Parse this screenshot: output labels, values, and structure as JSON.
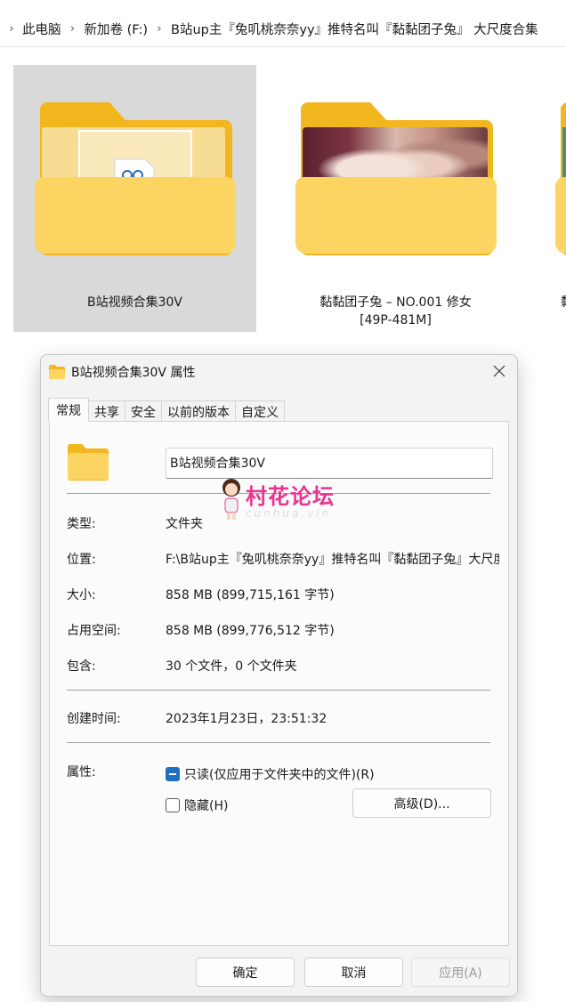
{
  "breadcrumb": {
    "items": [
      "此电脑",
      "新加卷 (F:)",
      "B站up主『兔叽桃奈奈yy』推特名叫『黏黏团子兔』 大尺度合集"
    ]
  },
  "tiles": [
    {
      "name_lines": [
        "B站视频合集30V"
      ],
      "selected": true
    },
    {
      "name_lines": [
        "黏黏团子兔 – NO.001 修女",
        "[49P-481M]"
      ],
      "selected": false
    },
    {
      "name_lines": [
        "黏"
      ],
      "selected": false
    }
  ],
  "dialog": {
    "title": "B站视频合集30V 属性",
    "tabs": [
      "常规",
      "共享",
      "安全",
      "以前的版本",
      "自定义"
    ],
    "active_tab": 0,
    "folder_name": "B站视频合集30V",
    "watermark": {
      "text": "村花论坛",
      "sub": "cunhua.vin"
    },
    "rows": {
      "type": {
        "label": "类型:",
        "value": "文件夹"
      },
      "location": {
        "label": "位置:",
        "value": "F:\\B站up主『兔叽桃奈奈yy』推特名叫『黏黏团子兔』大尺度合集"
      },
      "size": {
        "label": "大小:",
        "value": "858 MB (899,715,161 字节)"
      },
      "size_on_disk": {
        "label": "占用空间:",
        "value": "858 MB (899,776,512 字节)"
      },
      "contains": {
        "label": "包含:",
        "value": "30 个文件，0 个文件夹"
      },
      "created": {
        "label": "创建时间:",
        "value": "2023年1月23日，23:51:32"
      }
    },
    "attributes": {
      "label": "属性:",
      "readonly": "只读(仅应用于文件夹中的文件)(R)",
      "hidden": "隐藏(H)",
      "advanced": "高级(D)..."
    },
    "buttons": {
      "ok": "确定",
      "cancel": "取消",
      "apply": "应用(A)"
    }
  },
  "colors": {
    "folder_back": "#f2b61f",
    "folder_front": "#fcd462",
    "selection": "#d9d9d9",
    "checkbox_accent": "#1f6fbf",
    "watermark": "#e9348f"
  }
}
